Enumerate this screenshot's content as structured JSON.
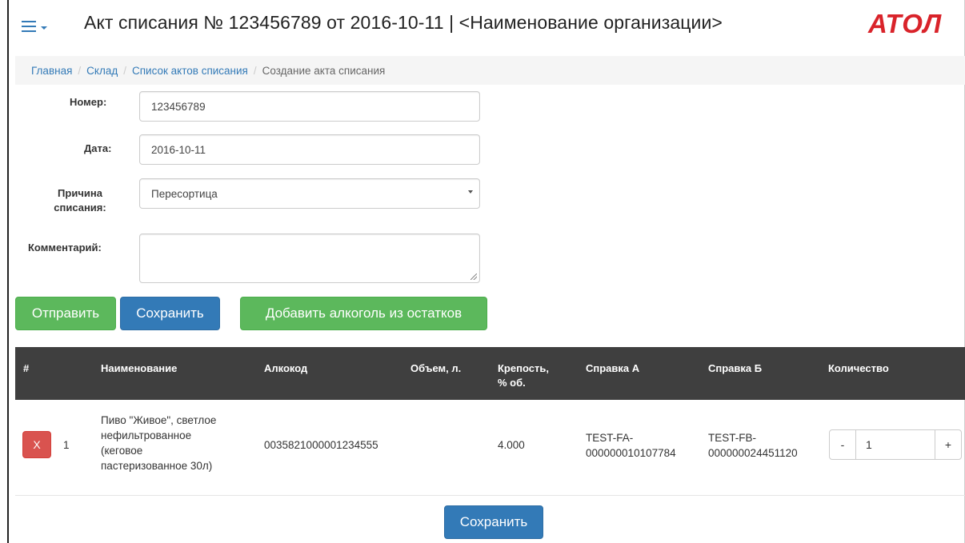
{
  "header": {
    "menu_icon": "hamburger-icon",
    "title": "Акт списания № 123456789 от 2016-10-11 | <Наименование организации>",
    "logo": "АТОЛ"
  },
  "breadcrumb": {
    "items": [
      "Главная",
      "Склад",
      "Список актов списания"
    ],
    "separator": "/",
    "current": "Создание акта списания"
  },
  "form": {
    "number_label": "Номер:",
    "number_value": "123456789",
    "date_label": "Дата:",
    "date_value": "2016-10-11",
    "reason_label_line1": "Причина",
    "reason_label_line2": "списания:",
    "reason_value": "Пересортица",
    "comment_label": "Комментарий:",
    "comment_value": ""
  },
  "actions": {
    "send": "Отправить",
    "save": "Сохранить",
    "add_from_stock": "Добавить алкоголь из остатков"
  },
  "table": {
    "columns": {
      "num": "#",
      "name": "Наименование",
      "alcocode": "Алкокод",
      "volume": "Объем, л.",
      "strength_line1": "Крепость,",
      "strength_line2": "% об.",
      "ref_a": "Справка А",
      "ref_b": "Справка Б",
      "quantity": "Количество"
    },
    "rows": [
      {
        "delete_label": "X",
        "num": "1",
        "name_lines": [
          "Пиво \"Живое\", светлое",
          "нефильтрованное",
          "(кеговое",
          "пастеризованное 30л)"
        ],
        "alcocode": "0035821000001234555",
        "volume": "",
        "strength": "4.000",
        "ref_a_lines": [
          "TEST-FA-",
          "000000010107784"
        ],
        "ref_b_lines": [
          "TEST-FB-",
          "000000024451120"
        ],
        "qty_minus": "-",
        "quantity": "1",
        "qty_plus": "+"
      }
    ]
  },
  "footer": {
    "save": "Сохранить"
  },
  "colors": {
    "primary": "#337ab7",
    "success": "#5cb85c",
    "danger": "#d9534f",
    "table_header": "#3f3f3f",
    "logo": "#d9232a"
  }
}
